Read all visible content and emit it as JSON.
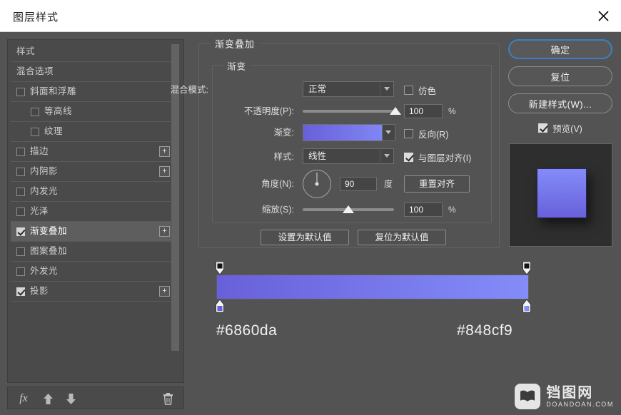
{
  "window": {
    "title": "图层样式",
    "close_icon": "close-icon"
  },
  "sidebar": {
    "items": [
      {
        "label": "样式",
        "checkbox": null,
        "sub": false,
        "plus": false,
        "selected": false
      },
      {
        "label": "混合选项",
        "checkbox": null,
        "sub": false,
        "plus": false,
        "selected": false
      },
      {
        "label": "斜面和浮雕",
        "checkbox": false,
        "sub": false,
        "plus": false,
        "selected": false
      },
      {
        "label": "等高线",
        "checkbox": false,
        "sub": true,
        "plus": false,
        "selected": false
      },
      {
        "label": "纹理",
        "checkbox": false,
        "sub": true,
        "plus": false,
        "selected": false
      },
      {
        "label": "描边",
        "checkbox": false,
        "sub": false,
        "plus": true,
        "selected": false
      },
      {
        "label": "内阴影",
        "checkbox": false,
        "sub": false,
        "plus": true,
        "selected": false
      },
      {
        "label": "内发光",
        "checkbox": false,
        "sub": false,
        "plus": false,
        "selected": false
      },
      {
        "label": "光泽",
        "checkbox": false,
        "sub": false,
        "plus": false,
        "selected": false
      },
      {
        "label": "渐变叠加",
        "checkbox": true,
        "sub": false,
        "plus": true,
        "selected": true
      },
      {
        "label": "图案叠加",
        "checkbox": false,
        "sub": false,
        "plus": false,
        "selected": false
      },
      {
        "label": "外发光",
        "checkbox": false,
        "sub": false,
        "plus": false,
        "selected": false
      },
      {
        "label": "投影",
        "checkbox": true,
        "sub": false,
        "plus": true,
        "selected": false
      }
    ],
    "toolbar": {
      "fx": "fx",
      "move_up_icon": "arrow-up-icon",
      "move_down_icon": "arrow-down-icon",
      "delete_icon": "trash-icon"
    }
  },
  "main": {
    "group_title": "渐变叠加",
    "inner_group_title": "渐变",
    "blend_mode": {
      "label": "混合模式:",
      "value": "正常"
    },
    "dither": {
      "label": "仿色",
      "checked": false
    },
    "opacity": {
      "label": "不透明度(P):",
      "value": "100",
      "unit": "%",
      "slider_pct": 100
    },
    "gradient": {
      "label": "渐变:",
      "start": "#6860da",
      "end": "#848cf9"
    },
    "reverse": {
      "label": "反向(R)",
      "checked": false
    },
    "style": {
      "label": "样式:",
      "value": "线性"
    },
    "align_with_layer": {
      "label": "与图层对齐(I)",
      "checked": true
    },
    "angle": {
      "label": "角度(N):",
      "value": "90",
      "unit": "度",
      "degrees": 90
    },
    "reset_align_button": "重置对齐",
    "scale": {
      "label": "缩放(S):",
      "value": "100",
      "unit": "%",
      "slider_pct": 47
    },
    "set_default_button": "设置为默认值",
    "reset_default_button": "复位为默认值"
  },
  "gradient_editor": {
    "stops": [
      {
        "position_pct": 0,
        "color": "#6860da",
        "hex_label": "#6860da"
      },
      {
        "position_pct": 100,
        "color": "#848cf9",
        "hex_label": "#848cf9"
      }
    ],
    "opacity_stops": [
      {
        "position_pct": 0,
        "opacity": 100
      },
      {
        "position_pct": 100,
        "opacity": 100
      }
    ],
    "left_hex": "#6860da",
    "right_hex": "#848cf9"
  },
  "right": {
    "ok_button": "确定",
    "reset_button": "复位",
    "new_style_button": "新建样式(W)...",
    "preview": {
      "label": "预览(V)",
      "checked": true
    },
    "accent_color": "#3d7fc4"
  },
  "watermark": {
    "cn": "铛图网",
    "en": "DOANDOAN.COM",
    "logo_icon": "book-logo-icon"
  }
}
